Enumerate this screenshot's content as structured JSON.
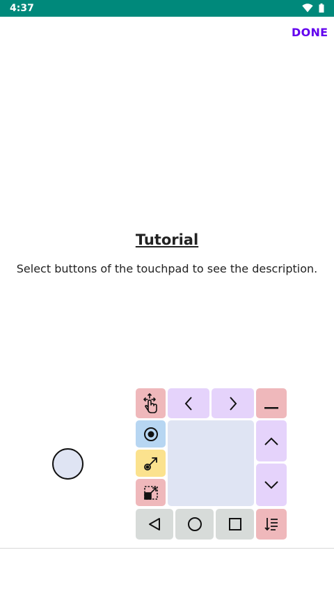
{
  "status_bar": {
    "time": "4:37",
    "wifi_icon": "wifi-icon",
    "battery_icon": "battery-icon"
  },
  "header": {
    "done_label": "DONE"
  },
  "tutorial": {
    "title": "Tutorial",
    "description": "Select buttons of the touchpad to see the description."
  },
  "touchpad": {
    "buttons": [
      {
        "name": "move-touchpad-button",
        "icon": "drag-hand-icon",
        "color": "#efb8bb"
      },
      {
        "name": "scroll-left-button",
        "icon": "chevron-left-icon",
        "color": "#e5d3fb"
      },
      {
        "name": "scroll-right-button",
        "icon": "chevron-right-icon",
        "color": "#e5d3fb"
      },
      {
        "name": "minimize-button",
        "icon": "minus-icon",
        "color": "#efb8bb"
      },
      {
        "name": "tap-button",
        "icon": "radio-target-icon",
        "color": "#b7d6f2"
      },
      {
        "name": "scroll-up-button",
        "icon": "chevron-up-icon",
        "color": "#e5d3fb"
      },
      {
        "name": "drag-swipe-button",
        "icon": "swipe-arrow-icon",
        "color": "#fbe28e"
      },
      {
        "name": "scroll-down-button",
        "icon": "chevron-down-icon",
        "color": "#e5d3fb"
      },
      {
        "name": "resize-button",
        "icon": "resize-icon",
        "color": "#efb8bb"
      },
      {
        "name": "back-nav-button",
        "icon": "triangle-back-icon",
        "color": "#d7dbd9"
      },
      {
        "name": "home-nav-button",
        "icon": "circle-home-icon",
        "color": "#d7dbd9"
      },
      {
        "name": "recents-nav-button",
        "icon": "square-recents-icon",
        "color": "#d7dbd9"
      },
      {
        "name": "sort-menu-button",
        "icon": "sort-list-icon",
        "color": "#efb8bb"
      }
    ],
    "pad_color": "#dfe4f3"
  },
  "colors": {
    "status_bar": "#00897b",
    "accent": "#6200ee"
  }
}
